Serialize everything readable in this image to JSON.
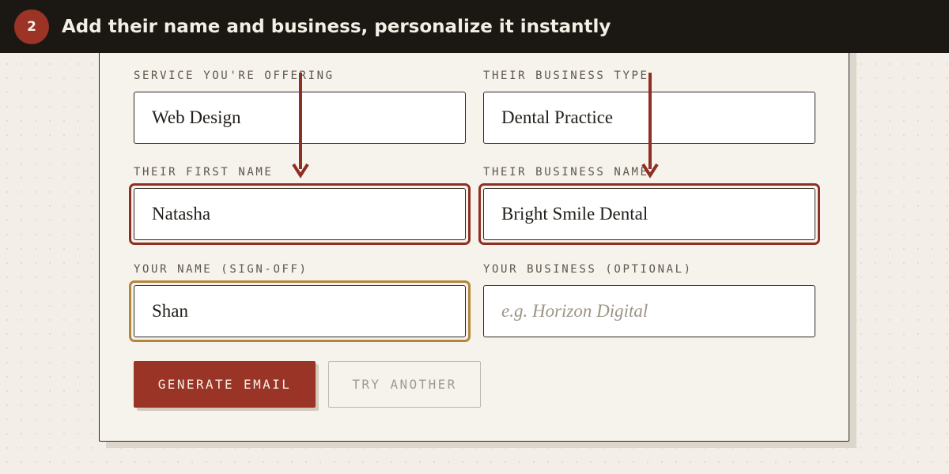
{
  "banner": {
    "step_number": "2",
    "title": "Add their name and business, personalize it instantly"
  },
  "form": {
    "service": {
      "label": "SERVICE YOU'RE OFFERING",
      "value": "Web Design"
    },
    "business_type": {
      "label": "THEIR BUSINESS TYPE",
      "value": "Dental Practice"
    },
    "first_name": {
      "label": "THEIR FIRST NAME",
      "value": "Natasha"
    },
    "business_name": {
      "label": "THEIR BUSINESS NAME",
      "value": "Bright Smile Dental"
    },
    "your_name": {
      "label": "YOUR NAME (SIGN-OFF)",
      "value": "Shan"
    },
    "your_business": {
      "label": "YOUR BUSINESS (OPTIONAL)",
      "value": "",
      "placeholder": "e.g. Horizon Digital"
    }
  },
  "actions": {
    "generate_label": "GENERATE EMAIL",
    "try_another_label": "TRY ANOTHER"
  },
  "colors": {
    "accent": "#993426",
    "highlight_red": "#8f2f24",
    "highlight_gold": "#b3863c",
    "banner_bg": "#1b1814",
    "page_bg": "#f3efe8"
  }
}
